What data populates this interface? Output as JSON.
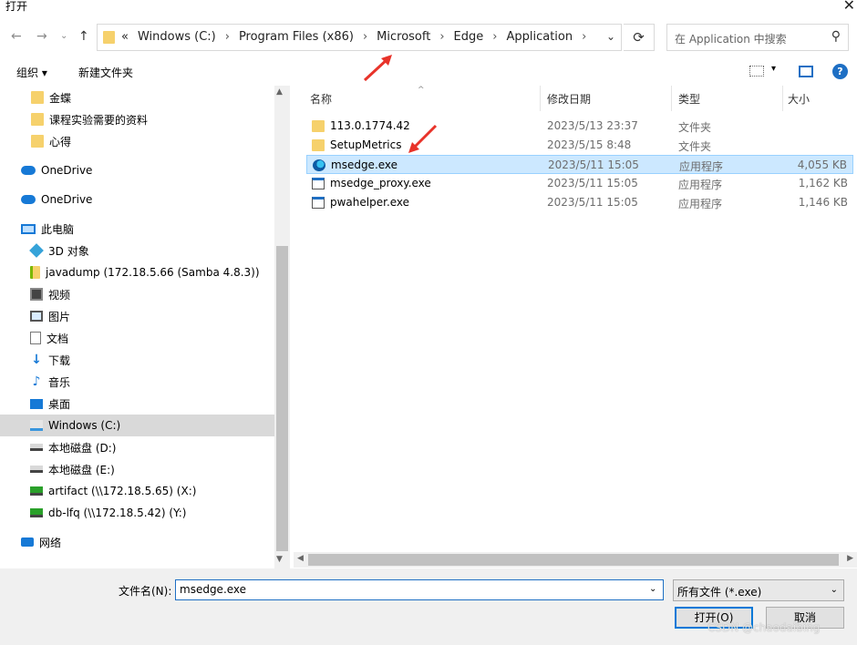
{
  "window": {
    "title": "打开",
    "close_glyph": "✕"
  },
  "nav": {
    "back": "←",
    "forward": "→",
    "recent": "⌄",
    "up": "↑",
    "address": {
      "chevrons": "«",
      "crumbs": [
        "Windows (C:)",
        "Program Files (x86)",
        "Microsoft",
        "Edge",
        "Application"
      ]
    },
    "refresh": "⟳",
    "search_placeholder": "在 Application 中搜索"
  },
  "toolbar": {
    "organize": "组织 ▾",
    "new_folder": "新建文件夹",
    "help": "?"
  },
  "sidebar": {
    "items": [
      {
        "label": "金蝶",
        "icon": "folder-icon"
      },
      {
        "label": "课程实验需要的资料",
        "icon": "folder-icon"
      },
      {
        "label": "心得",
        "icon": "folder-icon"
      },
      {
        "label": "OneDrive",
        "icon": "onedrive-icon"
      },
      {
        "label": "OneDrive",
        "icon": "onedrive-icon"
      },
      {
        "label": "此电脑",
        "icon": "this-pc-icon"
      },
      {
        "label": "3D 对象",
        "icon": "3d-objects-icon"
      },
      {
        "label": "javadump (172.18.5.66 (Samba 4.8.3))",
        "icon": "network-folder-icon"
      },
      {
        "label": "视频",
        "icon": "videos-icon"
      },
      {
        "label": "图片",
        "icon": "pictures-icon"
      },
      {
        "label": "文档",
        "icon": "documents-icon"
      },
      {
        "label": "下载",
        "icon": "downloads-icon"
      },
      {
        "label": "音乐",
        "icon": "music-icon"
      },
      {
        "label": "桌面",
        "icon": "desktop-icon"
      },
      {
        "label": "Windows (C:)",
        "icon": "windows-drive-icon",
        "selected": true
      },
      {
        "label": "本地磁盘 (D:)",
        "icon": "drive-icon"
      },
      {
        "label": "本地磁盘 (E:)",
        "icon": "drive-icon"
      },
      {
        "label": "artifact (\\\\172.18.5.65) (X:)",
        "icon": "network-drive-icon"
      },
      {
        "label": "db-lfq (\\\\172.18.5.42) (Y:)",
        "icon": "network-drive-icon"
      },
      {
        "label": "网络",
        "icon": "network-icon"
      }
    ]
  },
  "columns": {
    "name": "名称",
    "date": "修改日期",
    "type": "类型",
    "size": "大小"
  },
  "files": [
    {
      "name": "113.0.1774.42",
      "date": "2023/5/13 23:37",
      "type": "文件夹",
      "size": "",
      "icon": "folder-icon"
    },
    {
      "name": "SetupMetrics",
      "date": "2023/5/15 8:48",
      "type": "文件夹",
      "size": "",
      "icon": "folder-icon"
    },
    {
      "name": "msedge.exe",
      "date": "2023/5/11 15:05",
      "type": "应用程序",
      "size": "4,055 KB",
      "icon": "edge-icon",
      "selected": true
    },
    {
      "name": "msedge_proxy.exe",
      "date": "2023/5/11 15:05",
      "type": "应用程序",
      "size": "1,162 KB",
      "icon": "exe-icon"
    },
    {
      "name": "pwahelper.exe",
      "date": "2023/5/11 15:05",
      "type": "应用程序",
      "size": "1,146 KB",
      "icon": "exe-icon"
    }
  ],
  "bottom": {
    "filename_label": "文件名(N):",
    "filename_value": "msedge.exe",
    "filter_value": "所有文件 (*.exe)",
    "open_button": "打开(O)",
    "cancel_button": "取消"
  },
  "watermark": "CSDN @chaodaibing",
  "annotation_color": "#e8332a"
}
